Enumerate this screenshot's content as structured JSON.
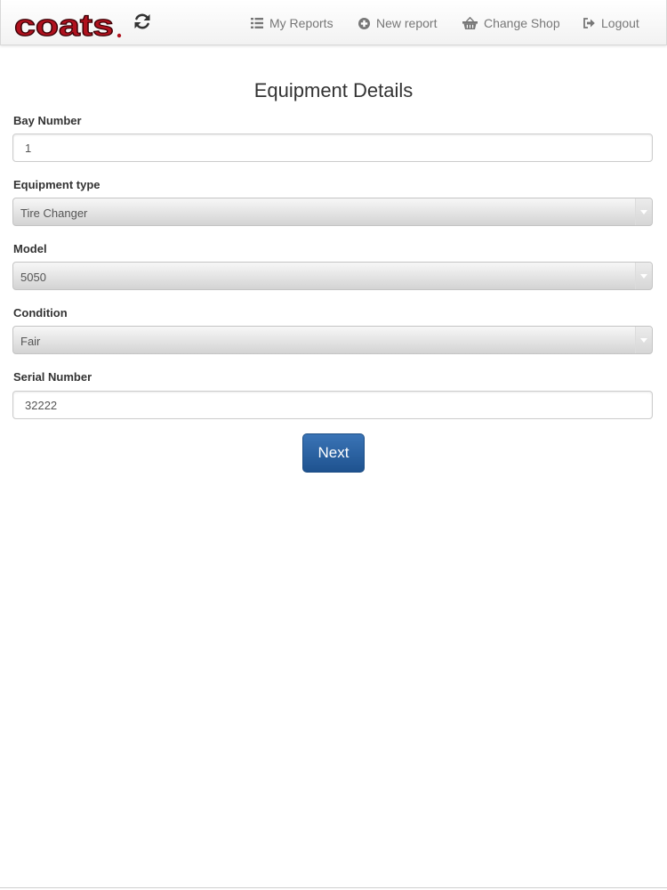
{
  "header": {
    "logo_text": "COATS",
    "logo_color": "#b0111e",
    "refresh_icon": "refresh-icon",
    "nav": [
      {
        "label": "My Reports",
        "icon": "list-icon"
      },
      {
        "label": "New report",
        "icon": "plus-circle-icon"
      },
      {
        "label": "Change Shop",
        "icon": "basket-icon"
      },
      {
        "label": "Logout",
        "icon": "logout-icon"
      }
    ]
  },
  "form": {
    "title": "Equipment Details",
    "bay_number": {
      "label": "Bay Number",
      "value": "1"
    },
    "equipment_type": {
      "label": "Equipment type",
      "value": "Tire Changer"
    },
    "model": {
      "label": "Model",
      "value": "5050"
    },
    "condition": {
      "label": "Condition",
      "value": "Fair"
    },
    "serial_number": {
      "label": "Serial Number",
      "value": "32222"
    },
    "next_label": "Next"
  },
  "colors": {
    "button_primary": "#2a63a3",
    "nav_text": "#777777"
  }
}
